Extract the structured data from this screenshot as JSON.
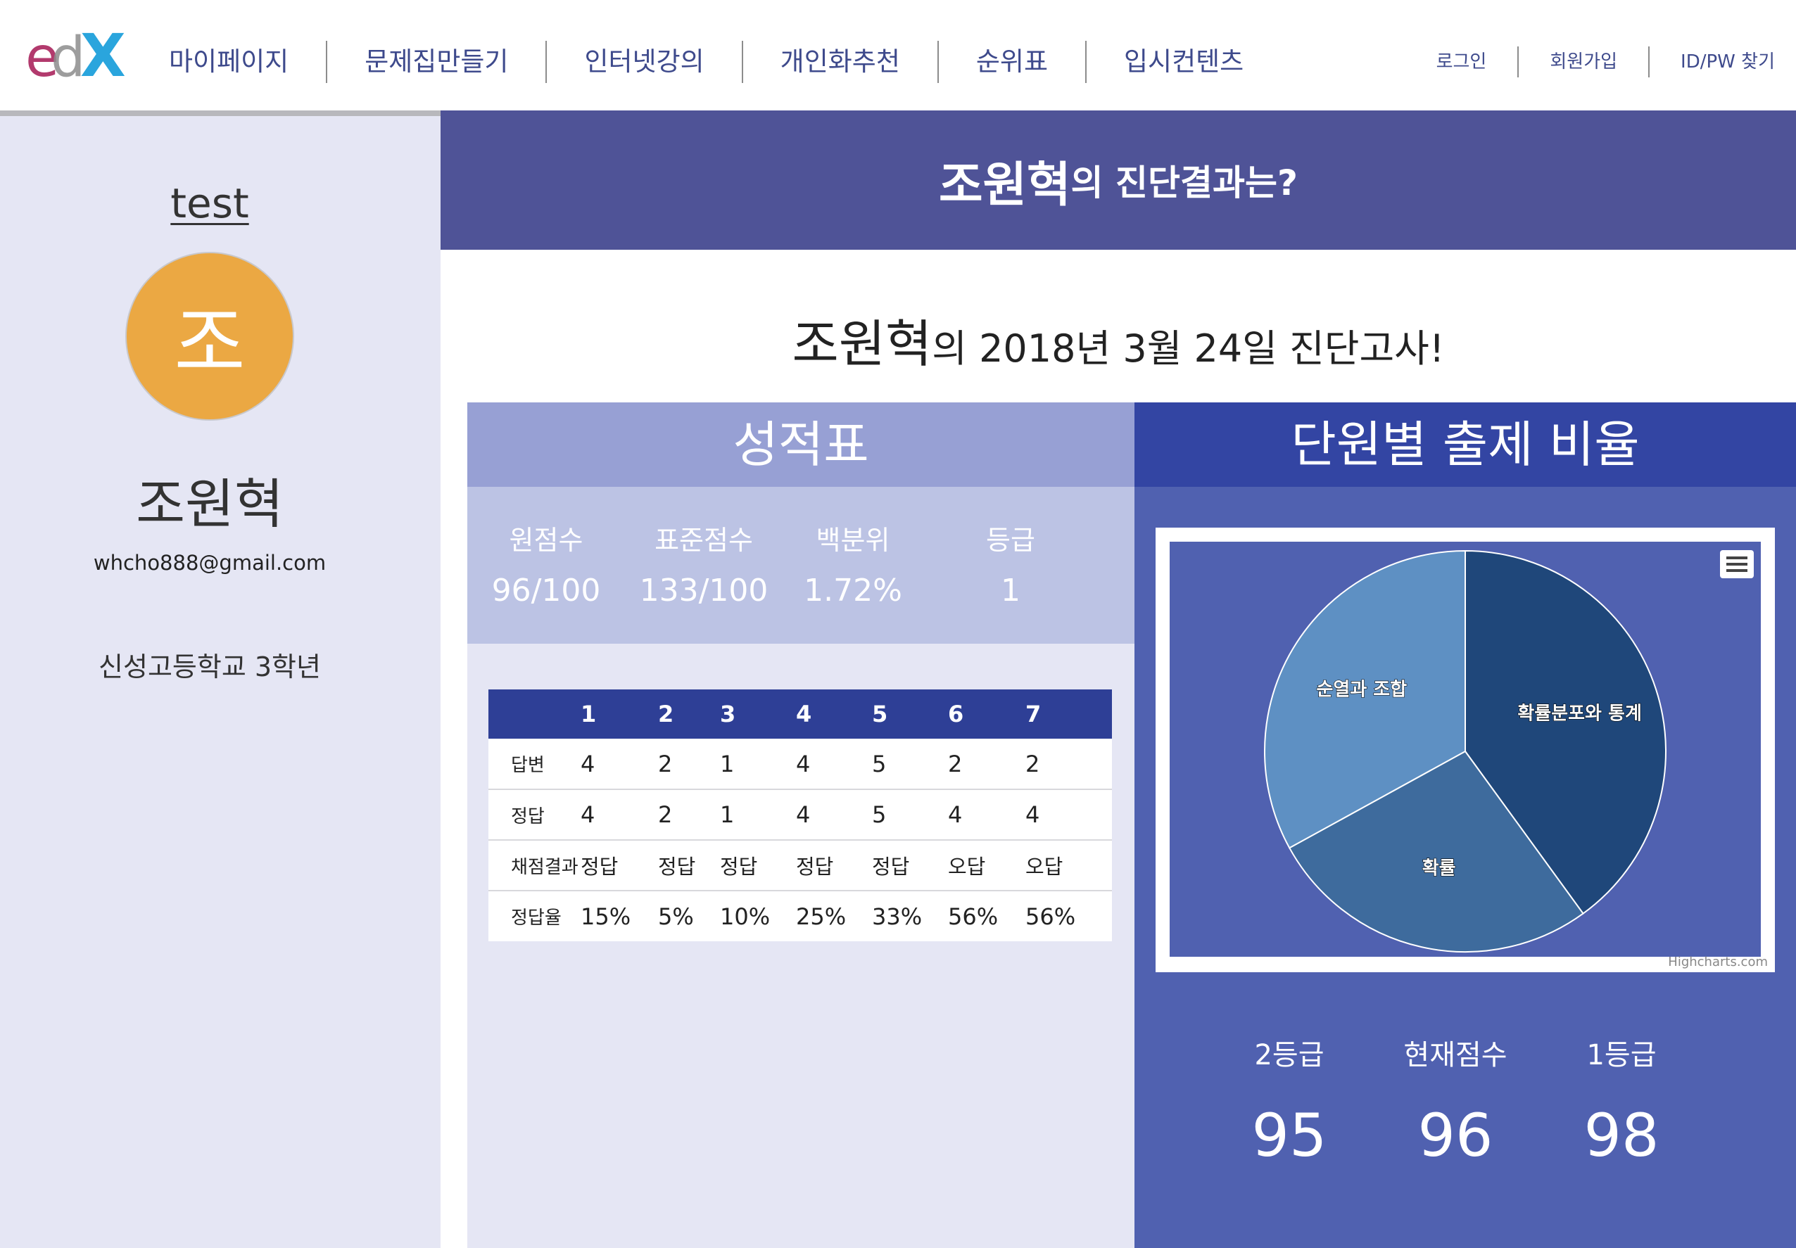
{
  "logo": {
    "text_e": "e",
    "text_d": "d",
    "text_x": "X"
  },
  "nav": {
    "items": [
      "마이페이지",
      "문제집만들기",
      "인터넷강의",
      "개인화추천",
      "순위표",
      "입시컨텐츠"
    ]
  },
  "auth": {
    "items": [
      "로그인",
      "회원가입",
      "ID/PW 찾기"
    ]
  },
  "sidebar": {
    "username": "test",
    "avatar_initial": "조",
    "name": "조원혁",
    "email": "whcho888@gmail.com",
    "school": "신성고등학교 3학년"
  },
  "banner": {
    "name": "조원혁",
    "suffix": "의 진단결과는?"
  },
  "exam": {
    "name": "조원혁",
    "suffix": "의 2018년 3월 24일 진단고사!"
  },
  "scorecard": {
    "title": "성적표",
    "summary": [
      {
        "label": "원점수",
        "value": "96/100"
      },
      {
        "label": "표준점수",
        "value": "133/100"
      },
      {
        "label": "백분위",
        "value": "1.72%"
      },
      {
        "label": "등급",
        "value": "1"
      }
    ],
    "table": {
      "headers": [
        "",
        "1",
        "2",
        "3",
        "4",
        "5",
        "6",
        "7"
      ],
      "rows": [
        {
          "label": "답변",
          "cells": [
            "4",
            "2",
            "1",
            "4",
            "5",
            "2",
            "2"
          ]
        },
        {
          "label": "정답",
          "cells": [
            "4",
            "2",
            "1",
            "4",
            "5",
            "4",
            "4"
          ]
        },
        {
          "label": "채점결과",
          "cells": [
            "정답",
            "정답",
            "정답",
            "정답",
            "정답",
            "오답",
            "오답"
          ]
        },
        {
          "label": "정답율",
          "cells": [
            "15%",
            "5%",
            "10%",
            "25%",
            "33%",
            "56%",
            "56%"
          ]
        }
      ]
    }
  },
  "chart_panel": {
    "title": "단원별 출제 비율",
    "credits": "Highcharts.com",
    "grades": [
      {
        "label": "2등급",
        "value": "95"
      },
      {
        "label": "현재점수",
        "value": "96"
      },
      {
        "label": "1등급",
        "value": "98"
      }
    ]
  },
  "colors": {
    "banner": "#4f5397",
    "sidebar": "#e5e6f4",
    "table_header": "#2e3f96",
    "chart_bg": "#5061b0",
    "avatar": "#eba843"
  },
  "chart_data": {
    "type": "pie",
    "title": "",
    "slices": [
      {
        "name": "확률분포와 통계",
        "value": 40,
        "color": "#1f477a"
      },
      {
        "name": "확률",
        "value": 27,
        "color": "#3e6b9d"
      },
      {
        "name": "순열과 조합",
        "value": 33,
        "color": "#5e90c3"
      }
    ]
  }
}
